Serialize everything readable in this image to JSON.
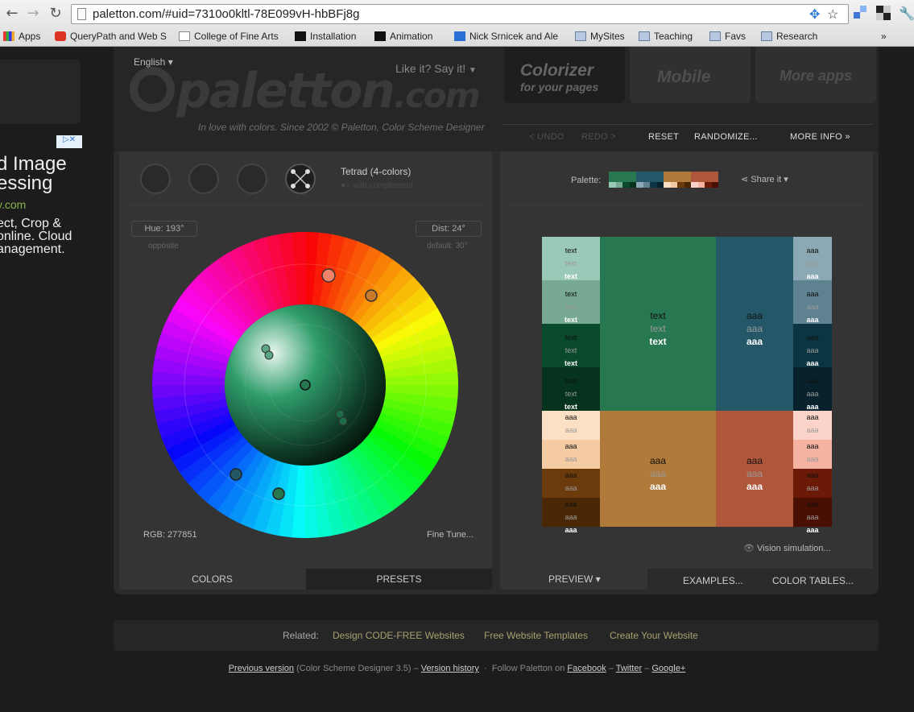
{
  "browser": {
    "url": "paletton.com/#uid=7310o0kltl-78E099vH-hbBFj8g",
    "bookmarks": [
      "Apps",
      "QueryPath and Web S",
      "College of Fine Arts",
      "Installation",
      "Animation",
      "Nick Srnicek and Ale",
      "MySites",
      "Teaching",
      "Favs",
      "Research"
    ],
    "overflow": "»"
  },
  "ad": {
    "title1": "d Image",
    "title2": "essing",
    "domain": "y.com",
    "line1": "ect, Crop &",
    "line2": "online. Cloud",
    "line3": "anagement.",
    "line4": "!"
  },
  "header": {
    "language": "English ▾",
    "logo": "paletton",
    "logo_suffix": ".com",
    "tagline": "In love with colors. Since 2002 © Paletton, Color Scheme Designer",
    "likeit": "Like it? Say it!",
    "tabs": [
      {
        "line1": "Colorizer",
        "line2": "for your pages"
      },
      {
        "line1": "Mobile",
        "line2": ""
      },
      {
        "line1": "More apps",
        "line2": ""
      }
    ],
    "undo": "< UNDO",
    "redo": "REDO >",
    "reset": "RESET",
    "randomize": "RANDOMIZE...",
    "more_info": "MORE INFO »"
  },
  "left": {
    "scheme_name": "Tetrad (4-colors)",
    "with_complement": "with complement",
    "hue": "Hue: 193°",
    "hue_sub": "opposite",
    "dist": "Dist: 24°",
    "dist_sub": "default: 30°",
    "rgb": "RGB: 277851",
    "finetune": "Fine Tune...",
    "tab_colors": "COLORS",
    "tab_presets": "PRESETS"
  },
  "right": {
    "palette_label": "Palette:",
    "share": "Share it ▾",
    "vision": "Vision simulation...",
    "tab_preview": "PREVIEW ▾",
    "tab_examples": "EXAMPLES...",
    "tab_tables": "COLOR TABLES...",
    "sample_text": "text",
    "sample_aaa": "aaa"
  },
  "colors": {
    "green": [
      "#9ac9b7",
      "#77a994",
      "#0a4a2c",
      "#05331e",
      "#277851"
    ],
    "blue": [
      "#8aa9b5",
      "#5f8290",
      "#0b3542",
      "#07222c",
      "#245868"
    ],
    "orange": [
      "#fce0c4",
      "#f5cba4",
      "#6b3b0c",
      "#4a2805",
      "#b07a3a"
    ],
    "red": [
      "#fcd3c8",
      "#f5b4a2",
      "#6b1a08",
      "#4a0f03",
      "#b0563a"
    ]
  },
  "related": {
    "label": "Related:",
    "links": [
      "Design CODE-FREE Websites",
      "Free Website Templates",
      "Create Your Website"
    ]
  },
  "footer": {
    "prev": "Previous version",
    "prev_note": "(Color Scheme Designer 3.5) –",
    "history": "Version history",
    "follow": "Follow Paletton on",
    "facebook": "Facebook",
    "twitter": "Twitter",
    "gplus": "Google+"
  }
}
